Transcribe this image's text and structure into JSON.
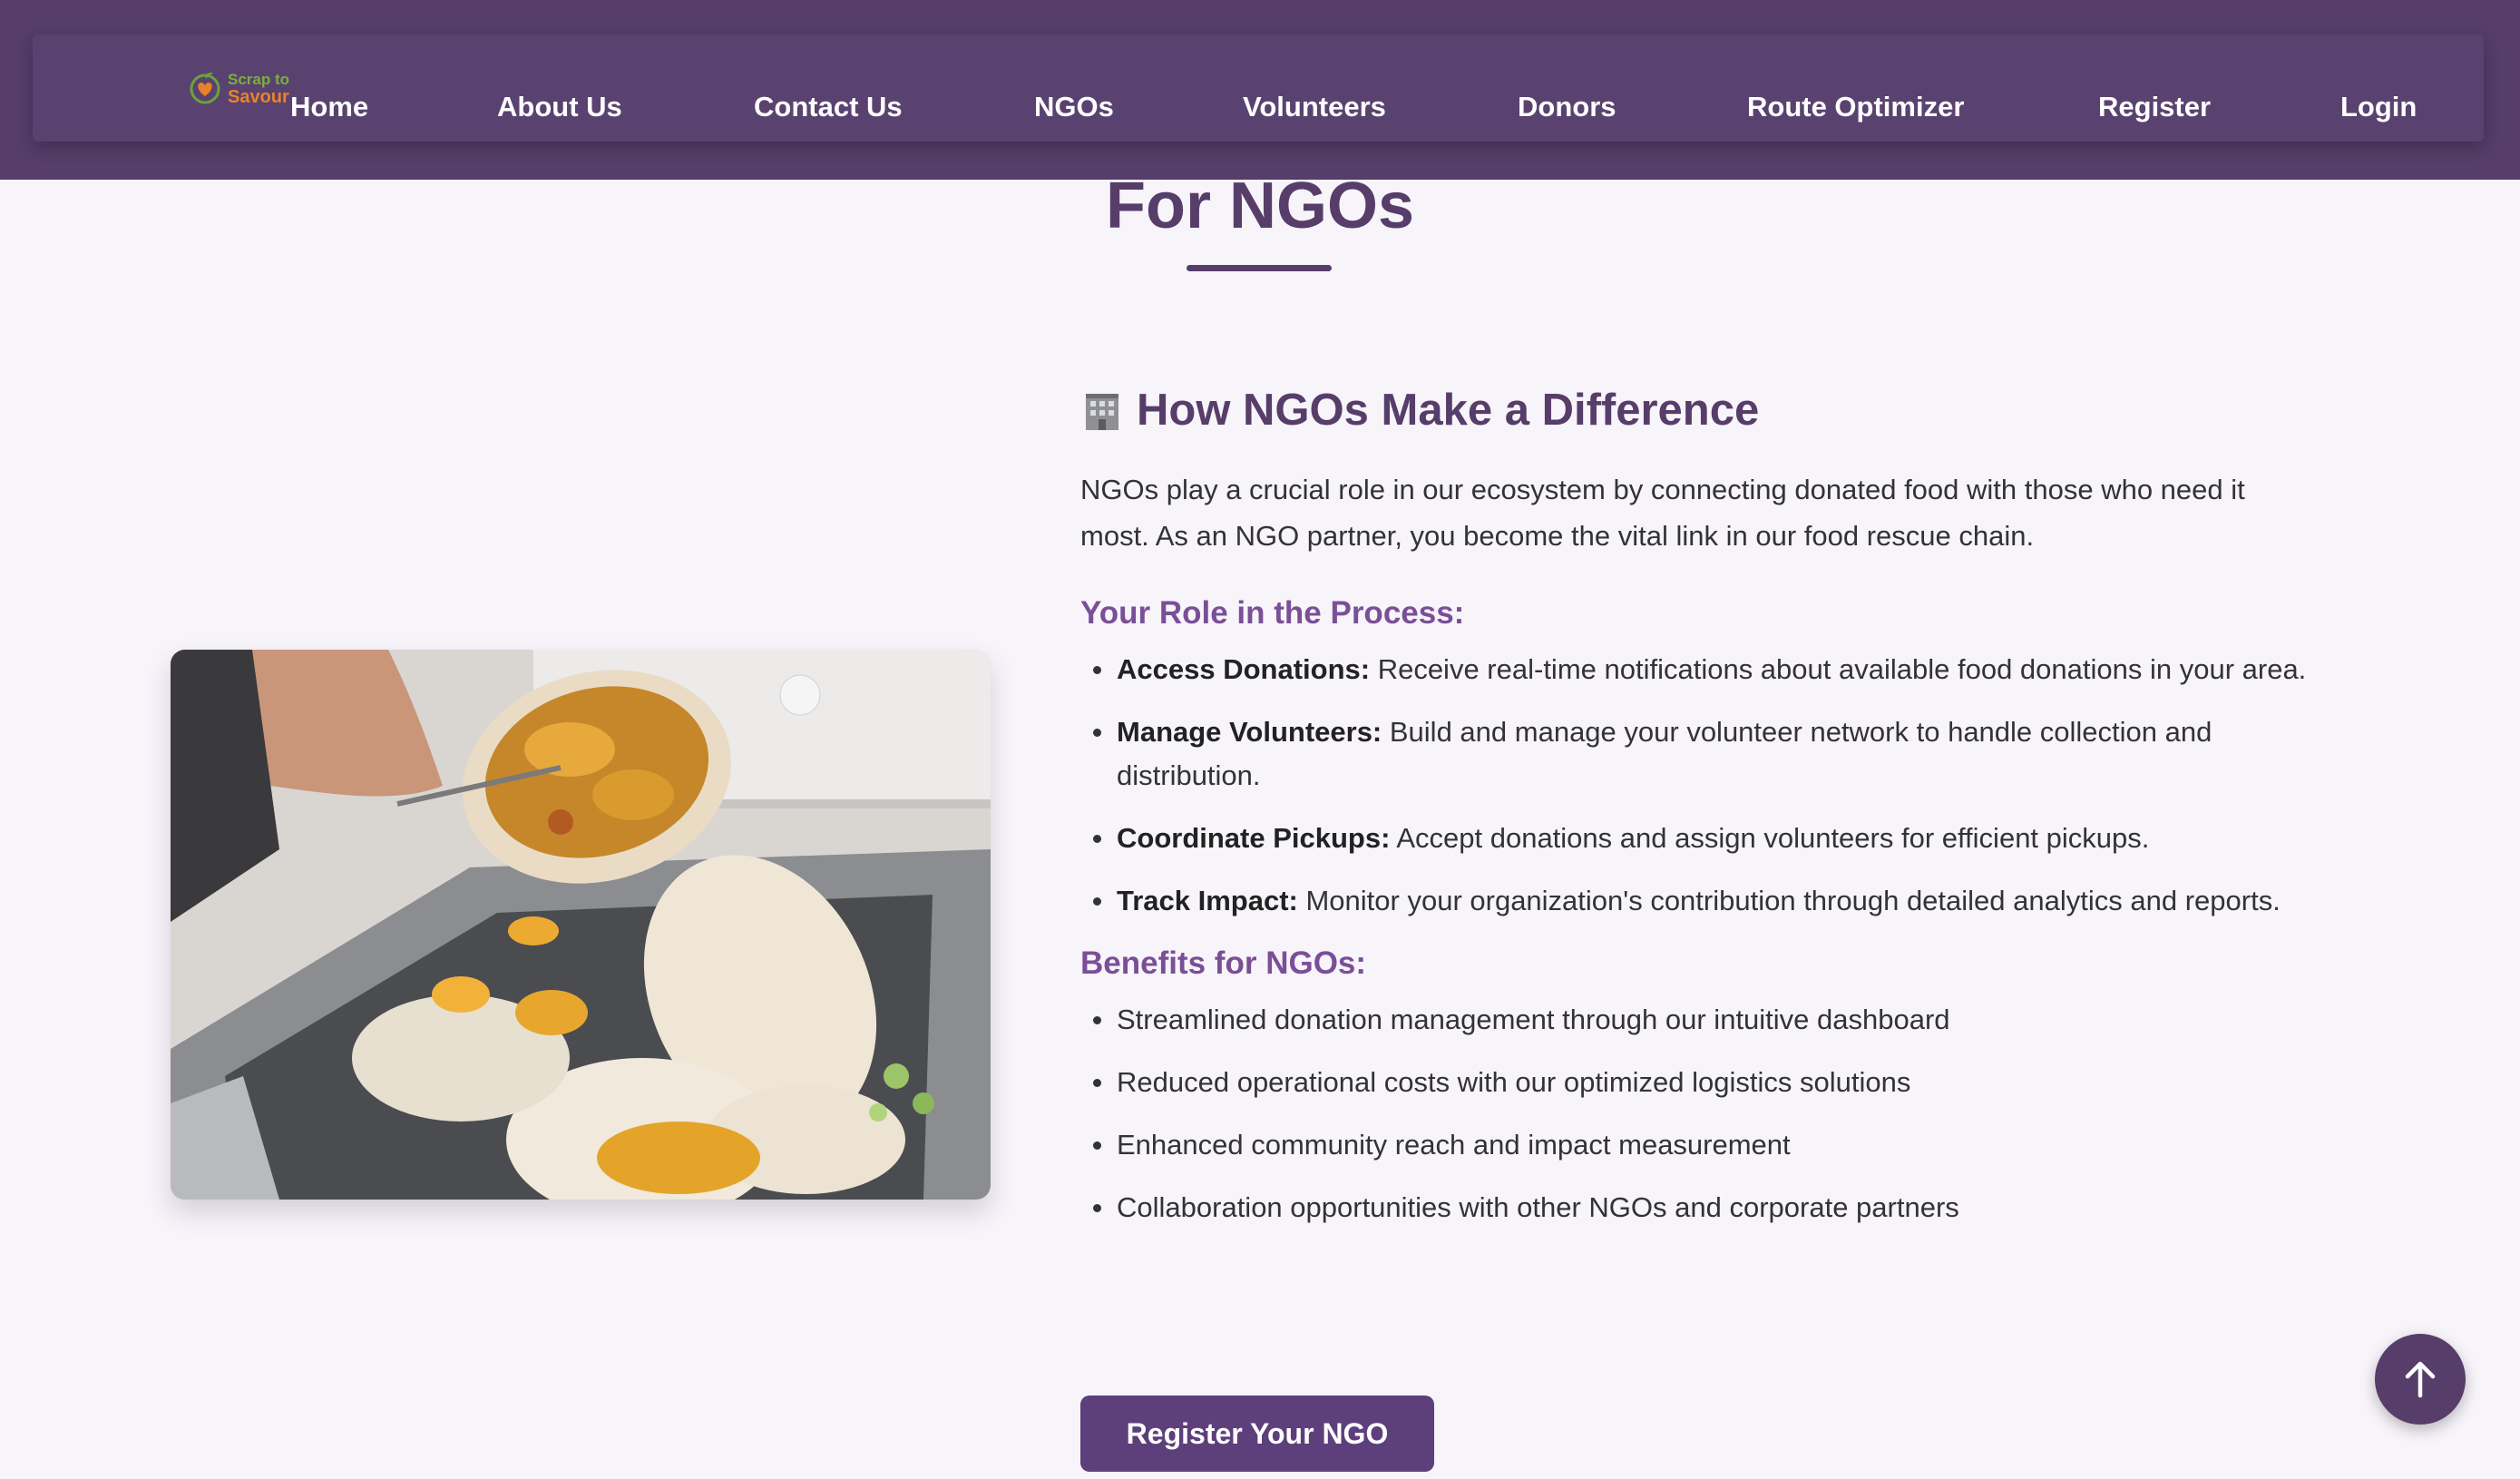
{
  "nav": {
    "logo_line1": "Scrap to",
    "logo_line2": "Savour",
    "links": [
      "Home",
      "About Us",
      "Contact Us",
      "NGOs",
      "Volunteers",
      "Donors",
      "Route Optimizer",
      "Register",
      "Login"
    ]
  },
  "page": {
    "title": "For NGOs"
  },
  "section": {
    "heading_icon": "building-icon",
    "heading": "How NGOs Make a Difference",
    "intro": "NGOs play a crucial role in our ecosystem by connecting donated food with those who need it most. As an NGO partner, you become the vital link in our food rescue chain.",
    "role_heading": "Your Role in the Process:",
    "role_items": [
      {
        "label": "Access Donations:",
        "text": " Receive real-time notifications about available food donations in your area."
      },
      {
        "label": "Manage Volunteers:",
        "text": " Build and manage your volunteer network to handle collection and distribution."
      },
      {
        "label": "Coordinate Pickups:",
        "text": " Accept donations and assign volunteers for efficient pickups."
      },
      {
        "label": "Track Impact:",
        "text": " Monitor your organization's contribution through detailed analytics and reports."
      }
    ],
    "benefits_heading": "Benefits for NGOs:",
    "benefits": [
      "Streamlined donation management through our intuitive dashboard",
      "Reduced operational costs with our optimized logistics solutions",
      "Enhanced community reach and impact measurement",
      "Collaboration opportunities with other NGOs and corporate partners"
    ],
    "cta_label": "Register Your NGO"
  },
  "colors": {
    "brand": "#563d6a",
    "accent": "#7a4f97",
    "background": "#f7f4fa"
  },
  "icons": {
    "scroll_top": "arrow-up-icon",
    "logo": "heart-leaf-icon"
  }
}
